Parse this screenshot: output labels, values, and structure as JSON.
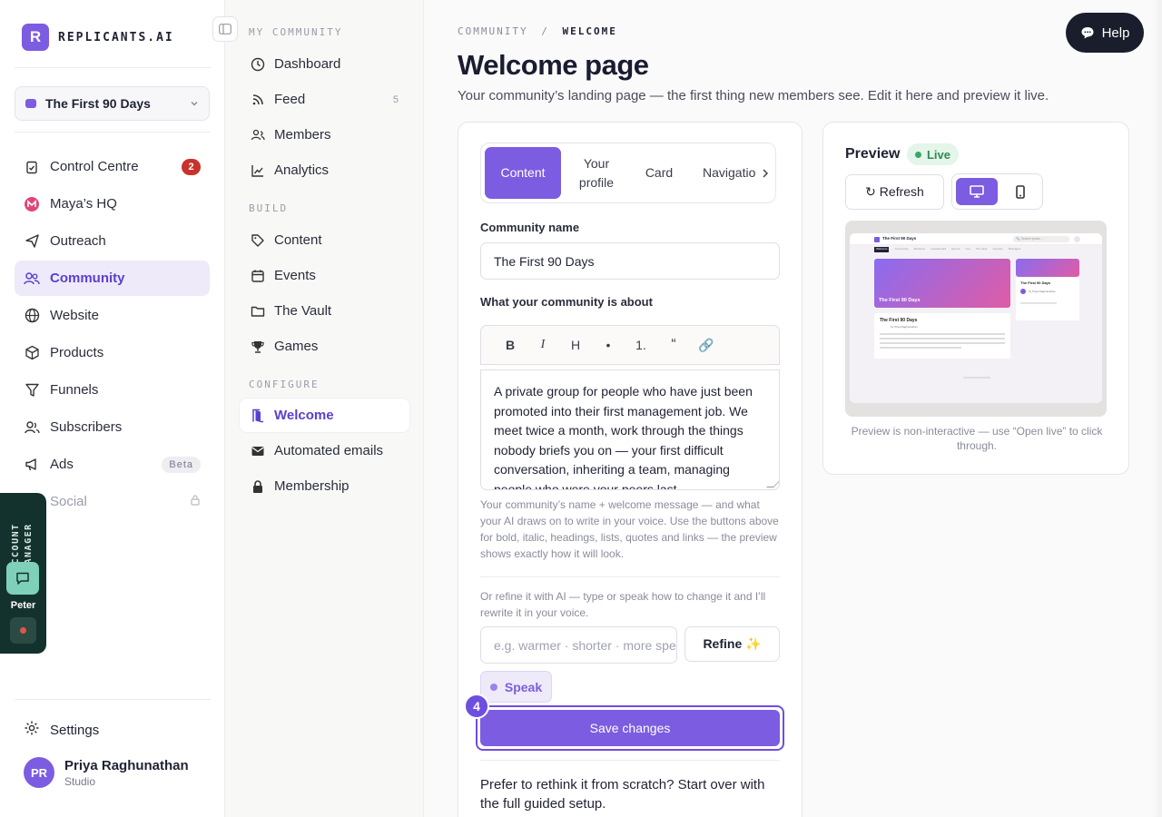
{
  "brand": {
    "logo_letter": "R",
    "name": "REPLICANTS.AI"
  },
  "workspace": {
    "name": "The First 90 Days"
  },
  "sidebar": {
    "items": [
      {
        "label": "Control Centre",
        "icon": "clipboard-icon",
        "badge": "2"
      },
      {
        "label": "Maya’s HQ",
        "icon": "maya-logo-icon"
      },
      {
        "label": "Outreach",
        "icon": "send-icon"
      },
      {
        "label": "Community",
        "icon": "users-icon",
        "active": true
      },
      {
        "label": "Website",
        "icon": "globe-icon"
      },
      {
        "label": "Products",
        "icon": "box-icon"
      },
      {
        "label": "Funnels",
        "icon": "funnel-icon"
      },
      {
        "label": "Subscribers",
        "icon": "subscribers-icon"
      },
      {
        "label": "Ads",
        "icon": "megaphone-icon",
        "badge": "Beta"
      },
      {
        "label": "Social",
        "icon": "lock-icon",
        "locked": true
      }
    ],
    "settings_label": "Settings",
    "user": {
      "initials": "PR",
      "name": "Priya Raghunathan",
      "role": "Studio"
    }
  },
  "account_manager": {
    "label": "ACCOUNT MANAGER",
    "name": "Peter"
  },
  "subnav": {
    "section_my": "MY COMMUNITY",
    "section_build": "BUILD",
    "section_configure": "CONFIGURE",
    "items_my": [
      {
        "label": "Dashboard"
      },
      {
        "label": "Feed",
        "count": "5"
      },
      {
        "label": "Members"
      },
      {
        "label": "Analytics"
      }
    ],
    "items_build": [
      {
        "label": "Content"
      },
      {
        "label": "Events"
      },
      {
        "label": "The Vault"
      },
      {
        "label": "Games"
      }
    ],
    "items_configure": [
      {
        "label": "Welcome"
      },
      {
        "label": "Automated emails"
      },
      {
        "label": "Membership"
      }
    ]
  },
  "main": {
    "breadcrumb_parent": "COMMUNITY",
    "breadcrumb_sep": "/",
    "breadcrumb_current": "WELCOME",
    "title": "Welcome page",
    "subtitle": "Your community’s landing page — the first thing new members see. Edit it here and preview it live.",
    "help_label": "Help"
  },
  "editor": {
    "tabs": [
      "Content",
      "Your profile",
      "Card",
      "Navigation"
    ],
    "community_name_label": "Community name",
    "community_name_value": "The First 90 Days",
    "about_label": "What your community is about",
    "toolbar": [
      "B",
      "I",
      "H",
      "•",
      "1.",
      "“",
      "🔗"
    ],
    "about_text": "A private group for people who have just been promoted into their first management job. We meet twice a month, work through the things nobody briefs you on — your first difficult conversation, inheriting a team, managing people who were your peers last",
    "about_hint": "Your community’s name + welcome message — and what your AI draws on to write in your voice. Use the buttons above for bold, italic, headings, lists, quotes and links — the preview shows exactly how it will look.",
    "refine_hint": "Or refine it with AI — type or speak how to change it and I’ll rewrite it in your voice.",
    "refine_placeholder": "e.g. warmer · shorter · more specific",
    "refine_label": "Refine ✨",
    "speak_label": "Speak",
    "step_number": "4",
    "save_label": "Save changes",
    "restart_text": "Prefer to rethink it from scratch? Start over with the full guided setup."
  },
  "preview": {
    "title": "Preview",
    "live_label": "Live",
    "refresh_label": "↻ Refresh",
    "note": "Preview is non-interactive — use “Open live” to click through.",
    "mini": {
      "site_title": "The First 90 Days",
      "search": "🔍 Search posts…",
      "tabs": [
        "Welcome",
        "Community",
        "Members",
        "Leaderboard",
        "Events",
        "Live",
        "The Vault",
        "Courses",
        "Messages"
      ],
      "hero_title": "The First 90 Days",
      "card_title": "The First 90 Days",
      "card_by": "by Priya Raghunathan",
      "side_title": "The First 90 Days",
      "side_by": "by Priya Raghunathan"
    }
  },
  "colors": {
    "accent": "#7c5ce0",
    "accent_dark": "#5b3fd1",
    "badge_red": "#c8322b",
    "live_green": "#38a864",
    "am_bg": "#14322d"
  }
}
